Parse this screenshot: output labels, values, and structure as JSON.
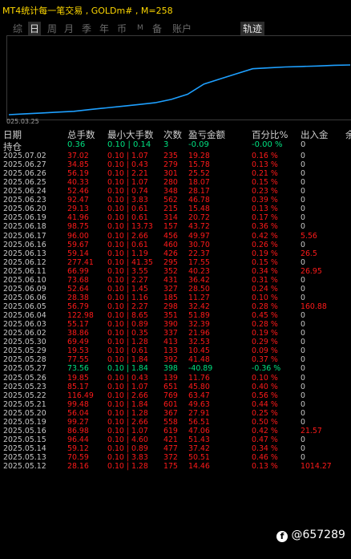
{
  "window": {
    "title": "MT4统计每一笔交易 , GOLDm# , M=258"
  },
  "tabs": [
    "综",
    "日",
    "周",
    "月",
    "季",
    "年",
    "币",
    "M",
    "备",
    "账户"
  ],
  "active_tab": "日",
  "track_tab": "轨迹",
  "chart_data": {
    "type": "line",
    "x_start_label": "025.03.25",
    "points": [
      0,
      0.5,
      1,
      1.5,
      2,
      3,
      4,
      5,
      6,
      7,
      9,
      12,
      18,
      21,
      24,
      27,
      27.5,
      28,
      28.3,
      28.6,
      29,
      29.2
    ],
    "color": "#1ea0ff"
  },
  "columns": {
    "date": "日期",
    "lots": "总手数",
    "minmax": "最小大手数",
    "count": "次数",
    "pnl": "盈亏金额",
    "pct": "百分比%",
    "io": "出入金",
    "extra": "余"
  },
  "summary": {
    "label": "持仓",
    "lots": "0.36",
    "minmax": "0.10 | 0.14",
    "count": "3",
    "pnl": "-0.09",
    "pct": "-0.00 %",
    "io": "0"
  },
  "rows": [
    {
      "d": "2025.07.02",
      "l": "37.02",
      "m": "0.10 | 1.07",
      "c": "235",
      "p": "19.28",
      "pc": "0.16 %",
      "io": "0",
      "g": false
    },
    {
      "d": "2025.06.27",
      "l": "34.85",
      "m": "0.10 | 0.43",
      "c": "279",
      "p": "15.78",
      "pc": "0.13 %",
      "io": "0",
      "g": false
    },
    {
      "d": "2025.06.26",
      "l": "56.19",
      "m": "0.10 | 2.21",
      "c": "301",
      "p": "25.52",
      "pc": "0.21 %",
      "io": "0",
      "g": false
    },
    {
      "d": "2025.06.25",
      "l": "40.33",
      "m": "0.10 | 1.07",
      "c": "280",
      "p": "18.07",
      "pc": "0.15 %",
      "io": "0",
      "g": false
    },
    {
      "d": "2025.06.24",
      "l": "52.46",
      "m": "0.10 | 0.74",
      "c": "348",
      "p": "28.17",
      "pc": "0.23 %",
      "io": "0",
      "g": false
    },
    {
      "d": "2025.06.23",
      "l": "92.47",
      "m": "0.10 | 3.83",
      "c": "562",
      "p": "46.78",
      "pc": "0.39 %",
      "io": "0",
      "g": false
    },
    {
      "d": "2025.06.20",
      "l": "29.13",
      "m": "0.10 | 0.61",
      "c": "215",
      "p": "15.48",
      "pc": "0.13 %",
      "io": "0",
      "g": false
    },
    {
      "d": "2025.06.19",
      "l": "41.96",
      "m": "0.10 | 0.61",
      "c": "314",
      "p": "20.72",
      "pc": "0.17 %",
      "io": "0",
      "g": false
    },
    {
      "d": "2025.06.18",
      "l": "98.75",
      "m": "0.10 | 13.73",
      "c": "157",
      "p": "43.72",
      "pc": "0.36 %",
      "io": "0",
      "g": false
    },
    {
      "d": "2025.06.17",
      "l": "96.00",
      "m": "0.10 | 2.66",
      "c": "456",
      "p": "49.97",
      "pc": "0.42 %",
      "io": "5.56",
      "g": false
    },
    {
      "d": "2025.06.16",
      "l": "59.67",
      "m": "0.10 | 0.61",
      "c": "460",
      "p": "30.70",
      "pc": "0.26 %",
      "io": "0",
      "g": false
    },
    {
      "d": "2025.06.13",
      "l": "59.14",
      "m": "0.10 | 1.19",
      "c": "426",
      "p": "22.37",
      "pc": "0.19 %",
      "io": "26.5",
      "g": false
    },
    {
      "d": "2025.06.12",
      "l": "277.41",
      "m": "0.10 | 41.35",
      "c": "295",
      "p": "17.55",
      "pc": "0.15 %",
      "io": "0",
      "g": false
    },
    {
      "d": "2025.06.11",
      "l": "66.99",
      "m": "0.10 | 3.55",
      "c": "352",
      "p": "40.23",
      "pc": "0.34 %",
      "io": "26.95",
      "g": false
    },
    {
      "d": "2025.06.10",
      "l": "73.68",
      "m": "0.10 | 2.27",
      "c": "431",
      "p": "36.42",
      "pc": "0.31 %",
      "io": "0",
      "g": false
    },
    {
      "d": "2025.06.09",
      "l": "52.64",
      "m": "0.10 | 1.45",
      "c": "327",
      "p": "28.50",
      "pc": "0.24 %",
      "io": "0",
      "g": false
    },
    {
      "d": "2025.06.06",
      "l": "28.38",
      "m": "0.10 | 1.16",
      "c": "185",
      "p": "11.27",
      "pc": "0.10 %",
      "io": "0",
      "g": false
    },
    {
      "d": "2025.06.05",
      "l": "56.79",
      "m": "0.10 | 2.27",
      "c": "298",
      "p": "32.42",
      "pc": "0.28 %",
      "io": "160.88",
      "g": false
    },
    {
      "d": "2025.06.04",
      "l": "122.98",
      "m": "0.10 | 8.65",
      "c": "351",
      "p": "51.89",
      "pc": "0.45 %",
      "io": "0",
      "g": false
    },
    {
      "d": "2025.06.03",
      "l": "55.17",
      "m": "0.10 | 0.89",
      "c": "390",
      "p": "32.39",
      "pc": "0.28 %",
      "io": "0",
      "g": false
    },
    {
      "d": "2025.06.02",
      "l": "38.86",
      "m": "0.10 | 0.35",
      "c": "337",
      "p": "21.96",
      "pc": "0.19 %",
      "io": "0",
      "g": false
    },
    {
      "d": "2025.05.30",
      "l": "69.49",
      "m": "0.10 | 1.28",
      "c": "413",
      "p": "32.53",
      "pc": "0.29 %",
      "io": "0",
      "g": false
    },
    {
      "d": "2025.05.29",
      "l": "19.53",
      "m": "0.10 | 0.61",
      "c": "133",
      "p": "10.45",
      "pc": "0.09 %",
      "io": "0",
      "g": false
    },
    {
      "d": "2025.05.28",
      "l": "77.55",
      "m": "0.10 | 1.84",
      "c": "392",
      "p": "41.48",
      "pc": "0.37 %",
      "io": "0",
      "g": false
    },
    {
      "d": "2025.05.27",
      "l": "73.56",
      "m": "0.10 | 1.84",
      "c": "398",
      "p": "-40.89",
      "pc": "-0.36 %",
      "io": "0",
      "g": true
    },
    {
      "d": "2025.05.26",
      "l": "19.85",
      "m": "0.10 | 0.43",
      "c": "139",
      "p": "11.76",
      "pc": "0.10 %",
      "io": "0",
      "g": false
    },
    {
      "d": "2025.05.23",
      "l": "85.17",
      "m": "0.10 | 1.07",
      "c": "651",
      "p": "45.80",
      "pc": "0.40 %",
      "io": "0",
      "g": false
    },
    {
      "d": "2025.05.22",
      "l": "116.49",
      "m": "0.10 | 2.66",
      "c": "769",
      "p": "63.47",
      "pc": "0.56 %",
      "io": "0",
      "g": false
    },
    {
      "d": "2025.05.21",
      "l": "99.48",
      "m": "0.10 | 1.84",
      "c": "601",
      "p": "49.63",
      "pc": "0.44 %",
      "io": "0",
      "g": false
    },
    {
      "d": "2025.05.20",
      "l": "56.04",
      "m": "0.10 | 1.28",
      "c": "367",
      "p": "27.91",
      "pc": "0.25 %",
      "io": "0",
      "g": false
    },
    {
      "d": "2025.05.19",
      "l": "99.27",
      "m": "0.10 | 2.66",
      "c": "558",
      "p": "56.51",
      "pc": "0.50 %",
      "io": "0",
      "g": false
    },
    {
      "d": "2025.05.16",
      "l": "86.98",
      "m": "0.10 | 1.07",
      "c": "619",
      "p": "47.06",
      "pc": "0.42 %",
      "io": "21.57",
      "g": false
    },
    {
      "d": "2025.05.15",
      "l": "96.44",
      "m": "0.10 | 4.60",
      "c": "421",
      "p": "51.43",
      "pc": "0.47 %",
      "io": "0",
      "g": false
    },
    {
      "d": "2025.05.14",
      "l": "59.12",
      "m": "0.10 | 0.89",
      "c": "477",
      "p": "37.42",
      "pc": "0.34 %",
      "io": "0",
      "g": false
    },
    {
      "d": "2025.05.13",
      "l": "70.59",
      "m": "0.10 | 3.83",
      "c": "372",
      "p": "50.51",
      "pc": "0.46 %",
      "io": "0",
      "g": false
    },
    {
      "d": "2025.05.12",
      "l": "28.16",
      "m": "0.10 | 1.28",
      "c": "175",
      "p": "14.46",
      "pc": "0.13 %",
      "io": "1014.27",
      "g": false
    }
  ],
  "watermark": "@657289",
  "colors": {
    "title": "#ffd800",
    "positive": "#ff1a1a",
    "negative": "#00e080",
    "line": "#1ea0ff"
  }
}
